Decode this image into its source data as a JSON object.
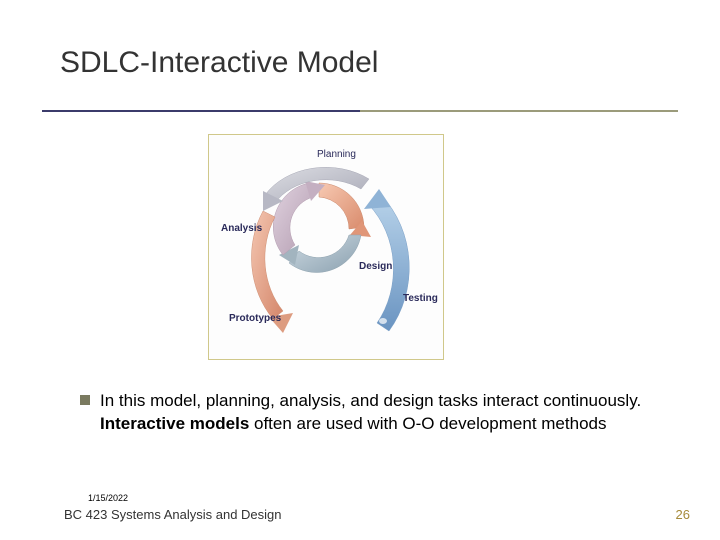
{
  "title": "SDLC-Interactive Model",
  "diagram": {
    "planning": "Planning",
    "analysis": "Analysis",
    "design": "Design",
    "prototypes": "Prototypes",
    "testing": "Testing"
  },
  "bullet": {
    "part1": "In this model, planning, analysis, and design tasks interact continuously. ",
    "bold": "Interactive models",
    "part2": " often are used with O-O development methods"
  },
  "date": "1/15/2022",
  "footer_left": "BC 423 Systems Analysis and Design",
  "slide_number": "26"
}
